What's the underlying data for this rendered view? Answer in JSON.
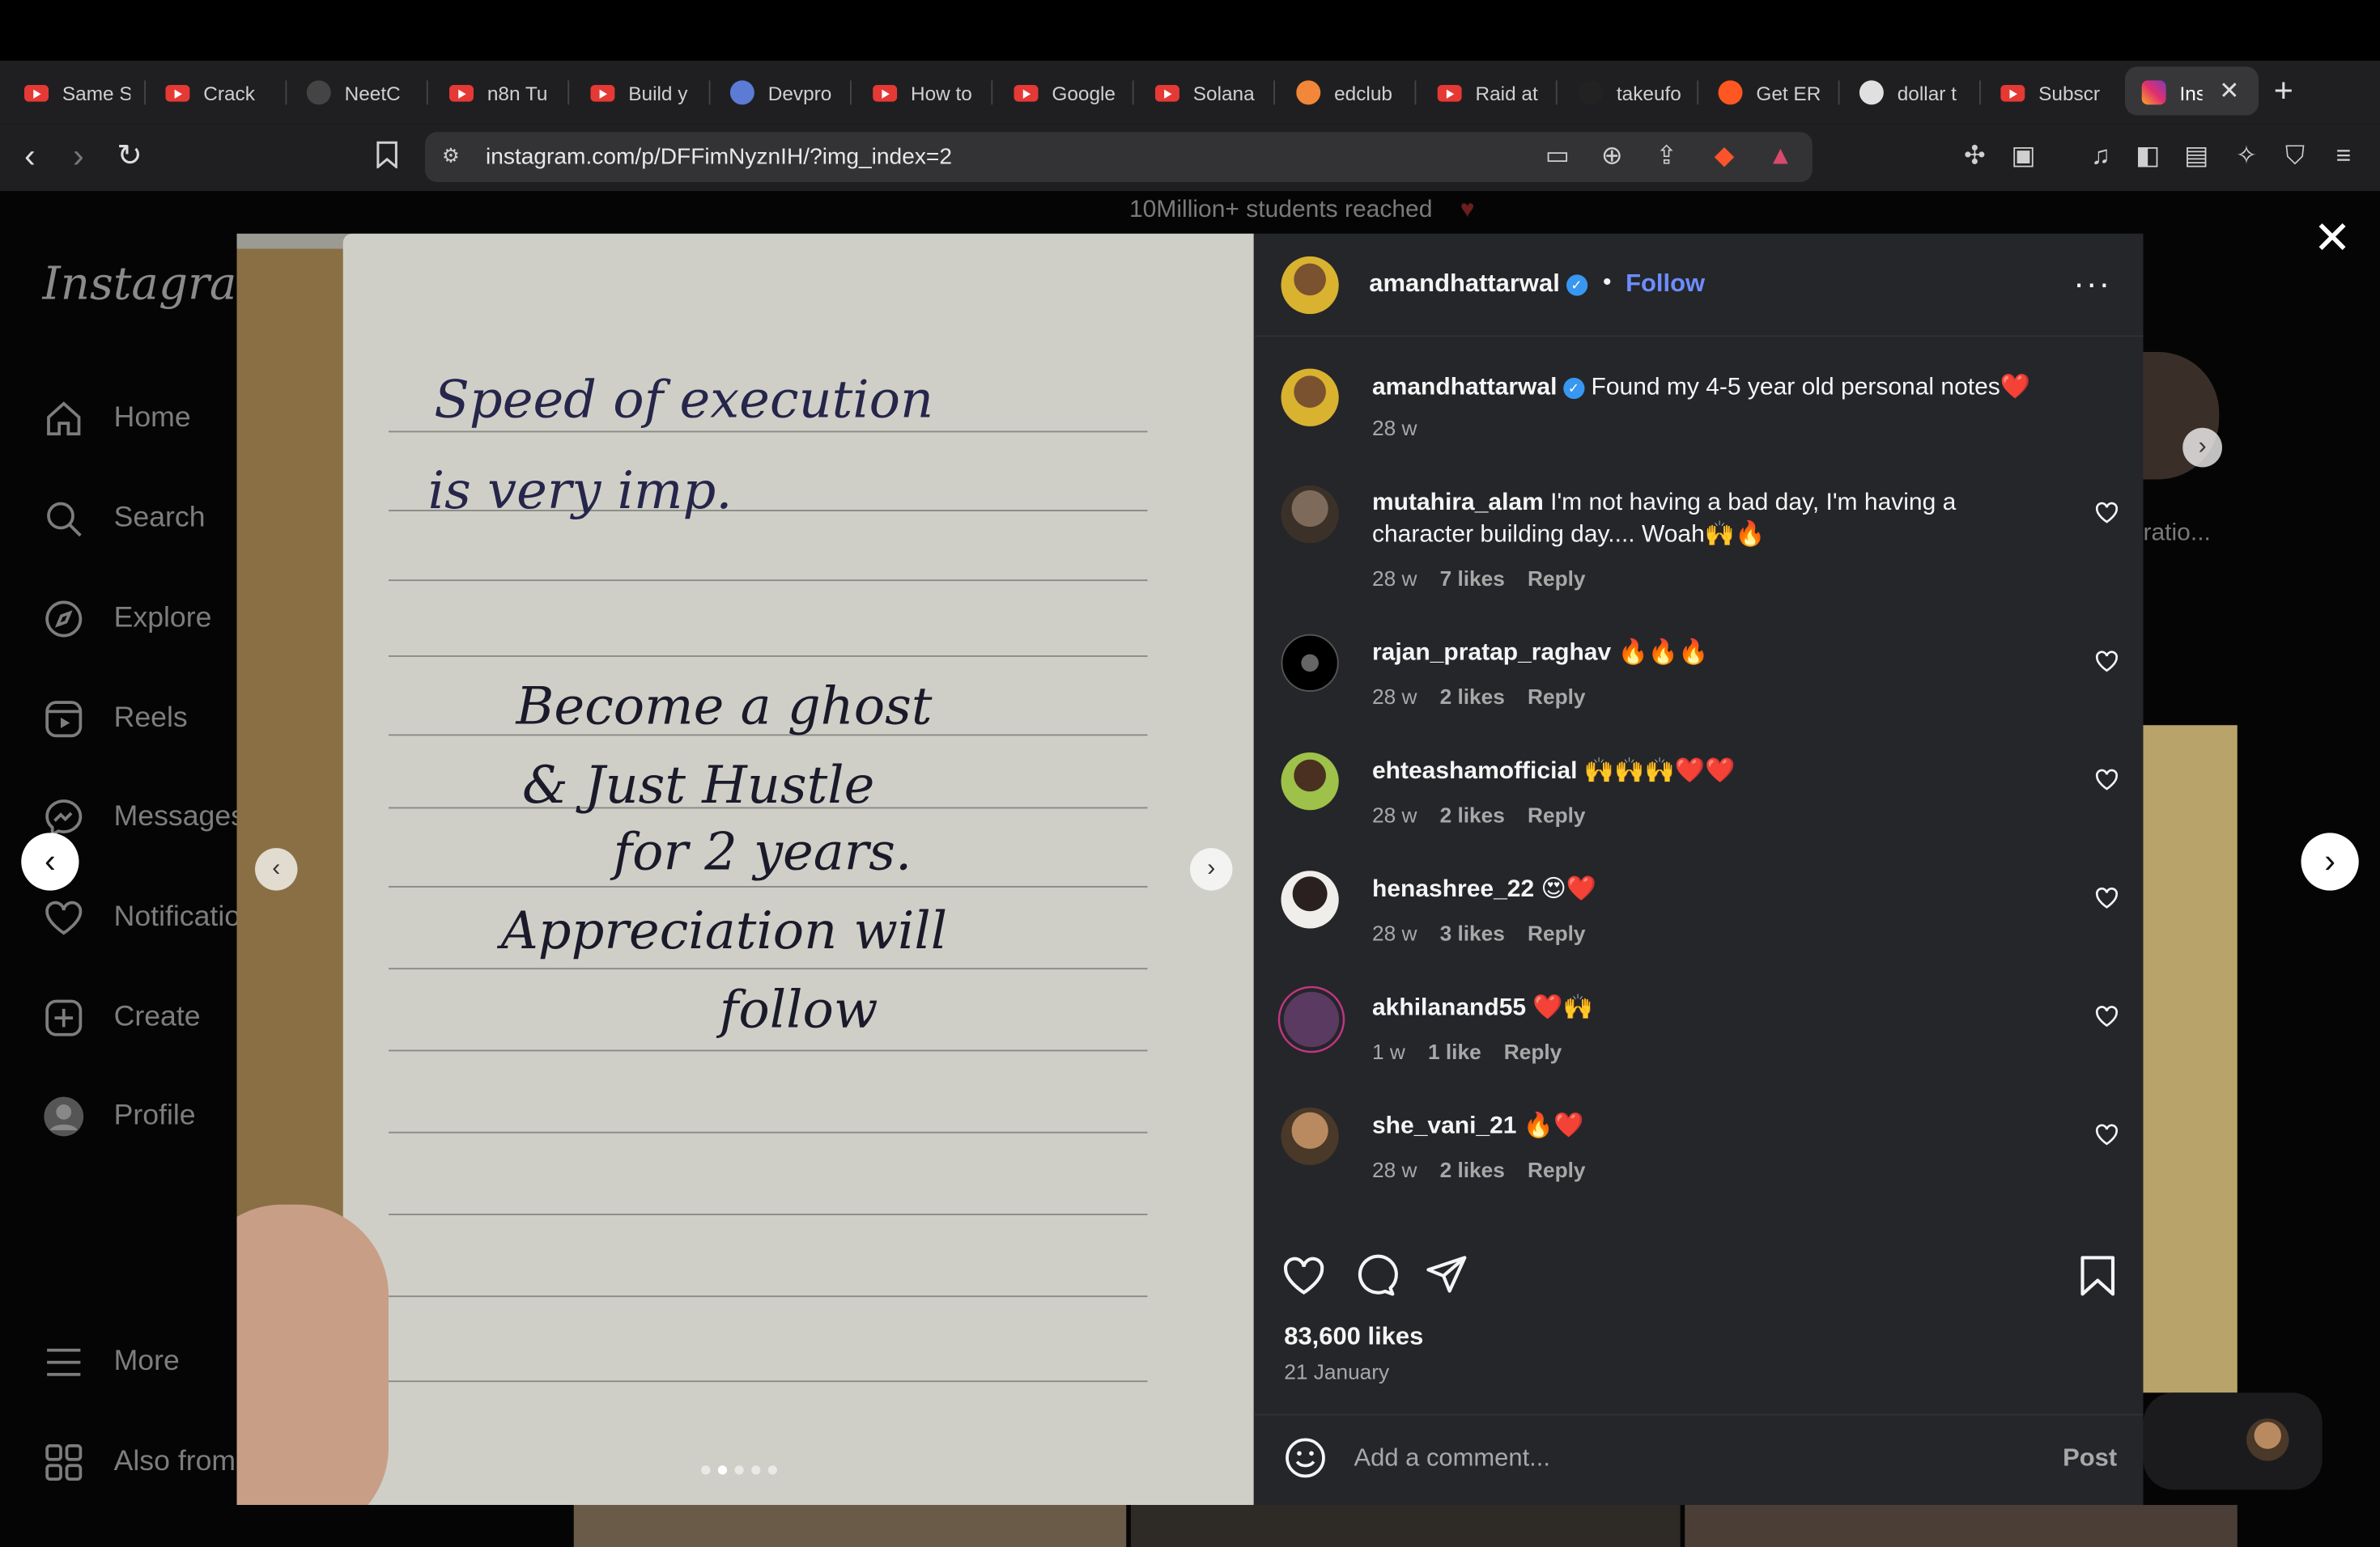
{
  "browser": {
    "tabs": [
      {
        "label": "Same S",
        "icon": "youtube-icon"
      },
      {
        "label": "Crack",
        "icon": "youtube-icon"
      },
      {
        "label": "NeetC",
        "icon": "neetcode-icon"
      },
      {
        "label": "n8n Tu",
        "icon": "youtube-icon"
      },
      {
        "label": "Build y",
        "icon": "youtube-icon"
      },
      {
        "label": "Devpro",
        "icon": "globe-icon"
      },
      {
        "label": "How to",
        "icon": "youtube-icon"
      },
      {
        "label": "Google",
        "icon": "youtube-icon"
      },
      {
        "label": "Solana",
        "icon": "youtube-icon"
      },
      {
        "label": "edclub",
        "icon": "edclub-icon"
      },
      {
        "label": "Raid at",
        "icon": "youtube-icon"
      },
      {
        "label": "takeufo",
        "icon": "takeuforward-icon"
      },
      {
        "label": "Get ER",
        "icon": "reddit-icon"
      },
      {
        "label": "dollar t",
        "icon": "chatgpt-icon"
      },
      {
        "label": "Subscr",
        "icon": "youtube-icon"
      },
      {
        "label": "Ins",
        "icon": "instagram-icon",
        "active": true
      }
    ],
    "url": "instagram.com/p/DFFimNyznIH/?img_index=2"
  },
  "sidebar": {
    "logo": "Instagram",
    "items": [
      {
        "label": "Home",
        "icon": "home-icon"
      },
      {
        "label": "Search",
        "icon": "search-icon"
      },
      {
        "label": "Explore",
        "icon": "compass-icon"
      },
      {
        "label": "Reels",
        "icon": "reels-icon"
      },
      {
        "label": "Messages",
        "icon": "messenger-icon"
      },
      {
        "label": "Notifications",
        "icon": "heart-icon"
      },
      {
        "label": "Create",
        "icon": "plus-square-icon"
      },
      {
        "label": "Profile",
        "icon": "avatar-icon"
      }
    ],
    "bottom": [
      {
        "label": "More",
        "icon": "menu-icon"
      },
      {
        "label": "Also from Meta",
        "icon": "grid-icon"
      }
    ]
  },
  "background": {
    "bio_line": "10Million+ students reached",
    "highlight_label": "ratio..."
  },
  "photo": {
    "notes": [
      "Speed of execution",
      "is very imp.",
      "Become a ghost",
      "& Just Hustle",
      "for 2 years.",
      "Appreciation will",
      "follow"
    ],
    "dots_total": 5,
    "dots_active": 2
  },
  "post": {
    "author": "amandhattarwal",
    "follow_label": "Follow",
    "caption": "Found my 4-5 year old personal notes❤️",
    "caption_age": "28 w",
    "comments": [
      {
        "user": "mutahira_alam",
        "text": "I'm not having a bad day, I'm having a character building day.... Woah🙌🔥",
        "age": "28 w",
        "likes": "7 likes",
        "reply": "Reply"
      },
      {
        "user": "rajan_pratap_raghav",
        "text": "🔥🔥🔥",
        "age": "28 w",
        "likes": "2 likes",
        "reply": "Reply"
      },
      {
        "user": "ehteashamofficial",
        "text": "🙌🙌🙌❤️❤️",
        "age": "28 w",
        "likes": "2 likes",
        "reply": "Reply"
      },
      {
        "user": "henashree_22",
        "text": "😍❤️",
        "age": "28 w",
        "likes": "3 likes",
        "reply": "Reply"
      },
      {
        "user": "akhilanand55",
        "text": "❤️🙌",
        "age": "1 w",
        "likes": "1 like",
        "reply": "Reply"
      },
      {
        "user": "she_vani_21",
        "text": "🔥❤️",
        "age": "28 w",
        "likes": "2 likes",
        "reply": "Reply"
      }
    ],
    "likes_count": "83,600 likes",
    "date": "21 January",
    "comment_placeholder": "Add a comment...",
    "post_label": "Post"
  },
  "colors": {
    "panel_bg": "#25262a",
    "link_blue": "#6d8dff",
    "verified_blue": "#3897f0"
  }
}
